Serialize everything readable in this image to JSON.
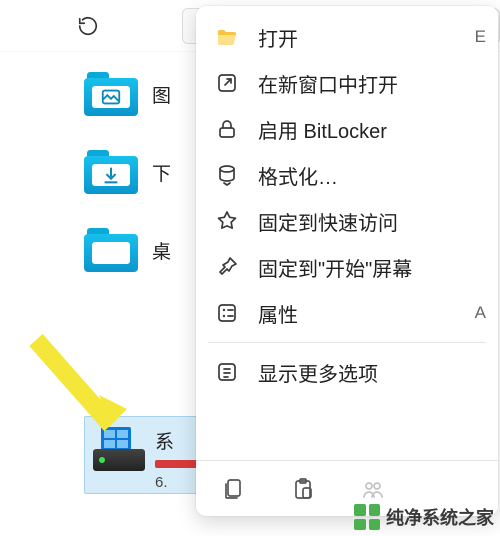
{
  "toolbar": {
    "refresh_tip": "刷新"
  },
  "folders": [
    {
      "label": "图",
      "glyph": "picture"
    },
    {
      "label": "下",
      "glyph": "download"
    },
    {
      "label": "桌",
      "glyph": "blank"
    }
  ],
  "drive": {
    "title": "系",
    "sub": "6."
  },
  "menu": {
    "items": [
      {
        "key": "open",
        "label": "打开",
        "icon": "folder-open",
        "shortcut": "E"
      },
      {
        "key": "open-new",
        "label": "在新窗口中打开",
        "icon": "new-window"
      },
      {
        "key": "bitlocker",
        "label": "启用 BitLocker",
        "icon": "lock"
      },
      {
        "key": "format",
        "label": "格式化…",
        "icon": "format-drive"
      },
      {
        "key": "pin-quick",
        "label": "固定到快速访问",
        "icon": "star"
      },
      {
        "key": "pin-start",
        "label": "固定到\"开始\"屏幕",
        "icon": "pin"
      },
      {
        "key": "properties",
        "label": "属性",
        "icon": "properties",
        "shortcut": "A"
      }
    ],
    "more": {
      "key": "more",
      "label": "显示更多选项",
      "icon": "more",
      "shortcut": ""
    }
  },
  "actionbar": {
    "icons": [
      "copy-icon",
      "paste-icon",
      "people-icon"
    ]
  },
  "watermark": {
    "text": "纯净系统之家"
  }
}
